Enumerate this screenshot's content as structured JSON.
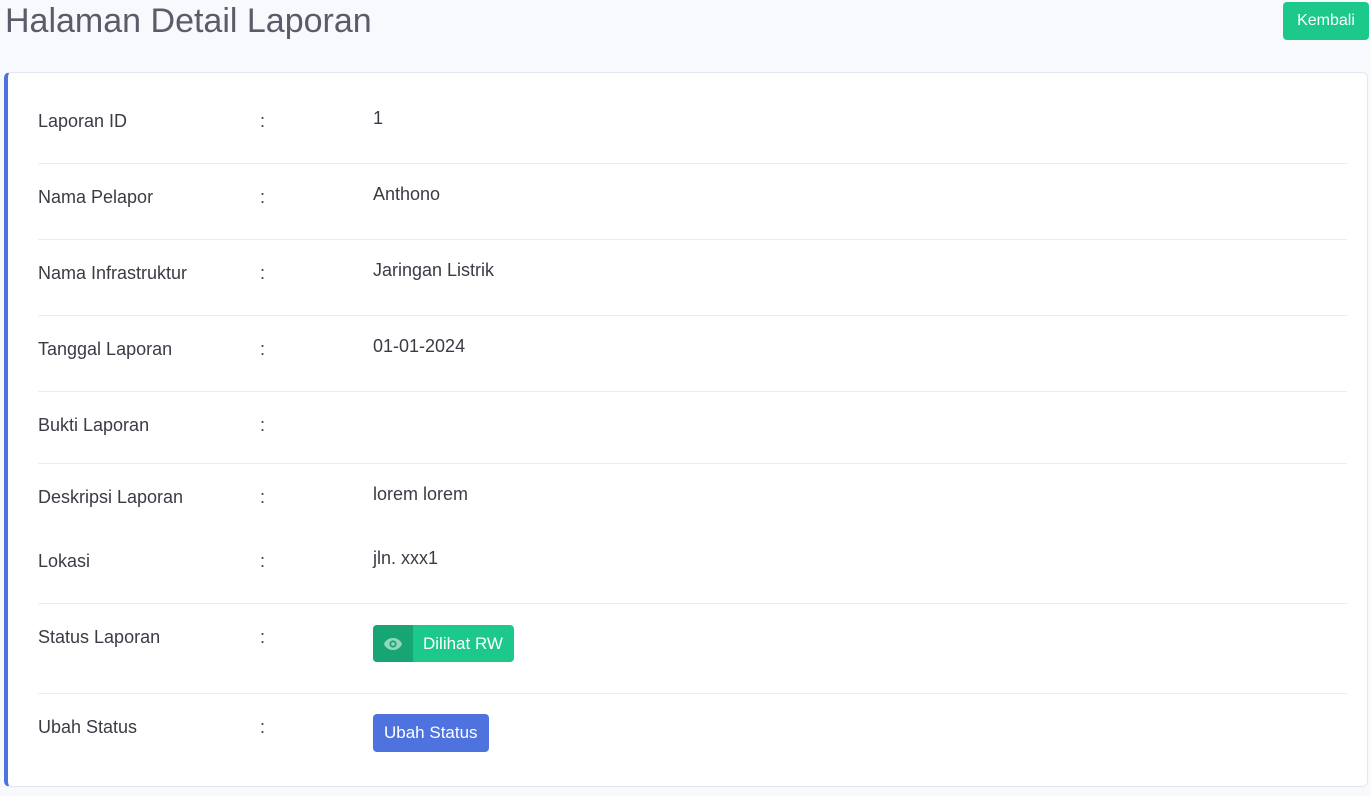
{
  "header": {
    "title": "Halaman Detail Laporan",
    "back_label": "Kembali"
  },
  "colors": {
    "accent_green": "#1cc88a",
    "accent_blue": "#4e73df"
  },
  "details": {
    "separator": ":",
    "report_id": {
      "label": "Laporan ID",
      "value": "1"
    },
    "reporter_name": {
      "label": "Nama Pelapor",
      "value": "Anthono"
    },
    "infrastructure_name": {
      "label": "Nama Infrastruktur",
      "value": "Jaringan Listrik"
    },
    "report_date": {
      "label": "Tanggal Laporan",
      "value": "01-01-2024"
    },
    "report_evidence": {
      "label": "Bukti Laporan",
      "value": ""
    },
    "report_description": {
      "label": "Deskripsi Laporan",
      "value": "lorem lorem"
    },
    "location": {
      "label": "Lokasi",
      "value": "jln. xxx1"
    },
    "report_status": {
      "label": "Status Laporan",
      "value": "Dilihat RW",
      "icon": "eye-icon"
    },
    "change_status": {
      "label": "Ubah Status",
      "button_label": "Ubah Status"
    }
  }
}
